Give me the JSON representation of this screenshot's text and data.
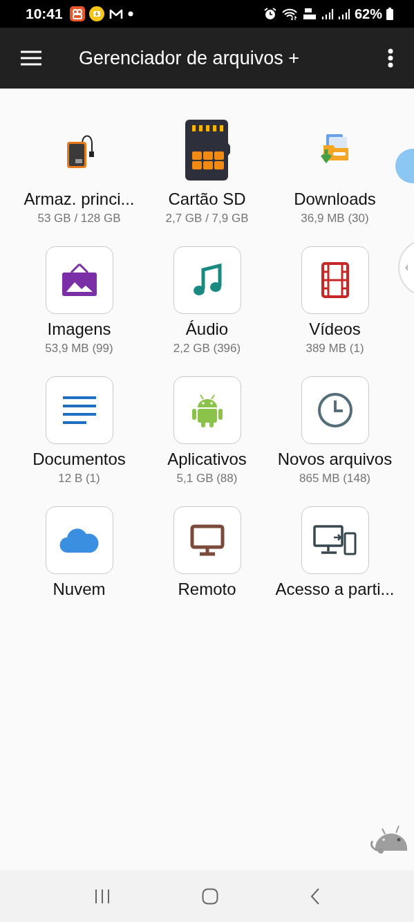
{
  "status_bar": {
    "time": "10:41",
    "battery": "62%"
  },
  "app_bar": {
    "title": "Gerenciador de arquivos +"
  },
  "items": [
    {
      "kind": "storage",
      "label": "Armaz. princi...",
      "detail": "53 GB / 128 GB"
    },
    {
      "kind": "sd",
      "label": "Cartão SD",
      "detail": "2,7 GB / 7,9 GB"
    },
    {
      "kind": "downloads",
      "label": "Downloads",
      "detail": "36,9 MB (30)"
    },
    {
      "kind": "images",
      "label": "Imagens",
      "detail": "53,9 MB (99)"
    },
    {
      "kind": "audio",
      "label": "Áudio",
      "detail": "2,2 GB (396)"
    },
    {
      "kind": "video",
      "label": "Vídeos",
      "detail": "389 MB (1)"
    },
    {
      "kind": "documents",
      "label": "Documentos",
      "detail": "12 B (1)"
    },
    {
      "kind": "apps",
      "label": "Aplicativos",
      "detail": "5,1 GB (88)"
    },
    {
      "kind": "recent",
      "label": "Novos arquivos",
      "detail": "865 MB (148)"
    },
    {
      "kind": "cloud",
      "label": "Nuvem"
    },
    {
      "kind": "remote",
      "label": "Remoto"
    },
    {
      "kind": "share",
      "label": "Acesso a parti..."
    }
  ]
}
